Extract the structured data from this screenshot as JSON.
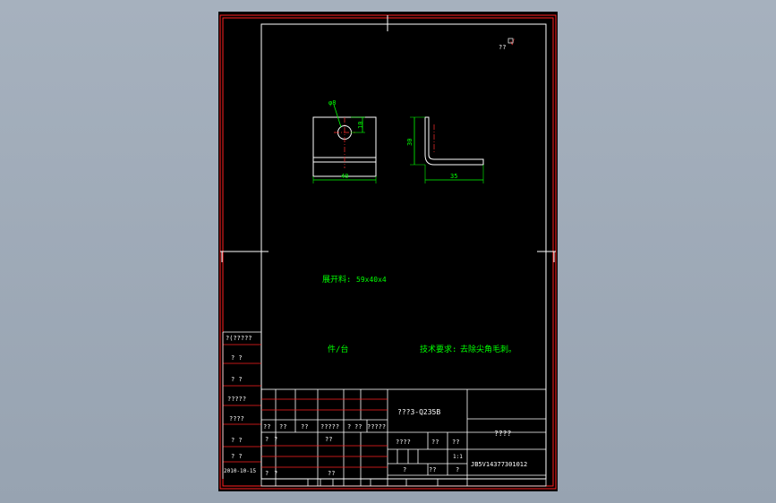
{
  "colors": {
    "background": "#9ea9b7",
    "sheet": "#000000",
    "frame": "#ff2020",
    "title_block": "#ffffff",
    "dimension": "#00ff00",
    "text_note": "#00ff00",
    "center_line": "#ff3030"
  },
  "corner_mark": {
    "text": "?? ",
    "roughness_symbol": "√"
  },
  "part_front_view": {
    "hole_label": "φ8",
    "dim_hole_offset": "10",
    "dim_width": "40"
  },
  "part_side_view": {
    "dim_height": "30",
    "dim_length": "35"
  },
  "notes": {
    "blank_size_label": "展开料:",
    "blank_size_value": "59x40x4",
    "quantity": "件/台",
    "tech_req_label": "技术要求:",
    "tech_req_value": "去除尖角毛刺。"
  },
  "left_strip": {
    "rows": [
      "?(?????",
      "?  ?",
      "?  ?",
      "?????",
      "????",
      "?  ?",
      "?  ?",
      "2010-10-15"
    ]
  },
  "title_block": {
    "material": "???3-Q235B",
    "part_name": "????",
    "drawing_number": "JB5V14377301012",
    "scale": "1:1",
    "header_row": [
      "??",
      "??",
      "??",
      "?????",
      "?",
      "??",
      "?????"
    ],
    "mid_labels": [
      "????",
      "??",
      "??"
    ],
    "bottom_labels": [
      "?",
      "??",
      "?"
    ],
    "sign_rows": [
      "?",
      "?",
      "??"
    ]
  }
}
